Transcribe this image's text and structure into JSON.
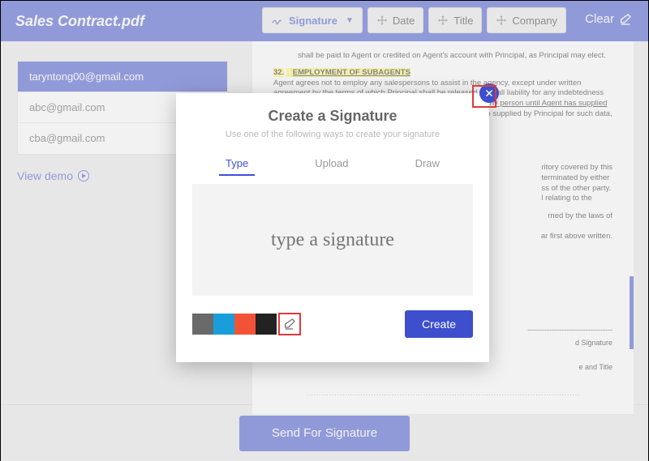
{
  "header": {
    "document_title": "Sales Contract.pdf",
    "toolbar": {
      "signature": "Signature",
      "date": "Date",
      "title": "Title",
      "company": "Company"
    },
    "clear": "Clear"
  },
  "sidebar": {
    "recipients": [
      {
        "email": "taryntong00@gmail.com",
        "active": true
      },
      {
        "email": "abc@gmail.com",
        "active": false
      },
      {
        "email": "cba@gmail.com",
        "active": false
      }
    ],
    "view_demo": "View demo"
  },
  "document": {
    "line_intro": "shall be paid to Agent or credited on Agent's account with Principal, as Principal may elect.",
    "section_number": "32.",
    "section_title": "EMPLOYMENT OF SUBAGENTS",
    "para1a": "Agent agrees not to employ any salespersons to assist in the agency, except under written agreement by the terms of which Principal shall be released from all liability for any indebtedness from Agent to such salespersons. ",
    "para1b": "Agent agrees not to employ any person until Agent has supplied Principal with full particulars regarding such",
    "para1c": " person, on the form supplied by Principal for such data, including name, age, address, education, etc., and until",
    "frag1": "ritory covered by this\nterminated by either\nss of the other party.\nl relating to the",
    "frag2": "rned by the laws of",
    "frag3": "ar first above written.",
    "sig_rule": "-----------------------------------",
    "sig_label1": "d Signature",
    "sig_label2": "e and Title",
    "dots": "........................................................................................................."
  },
  "footer": {
    "send_button": "Send For Signature"
  },
  "modal": {
    "title": "Create a Signature",
    "subtitle": "Use one of the following ways to create your signature",
    "tabs": {
      "type": "Type",
      "upload": "Upload",
      "draw": "Draw"
    },
    "placeholder": "type a signature",
    "create": "Create",
    "colors": {
      "gray": "#6a6a6a",
      "blue": "#1a9edb",
      "red": "#f25337",
      "black": "#222222"
    }
  }
}
